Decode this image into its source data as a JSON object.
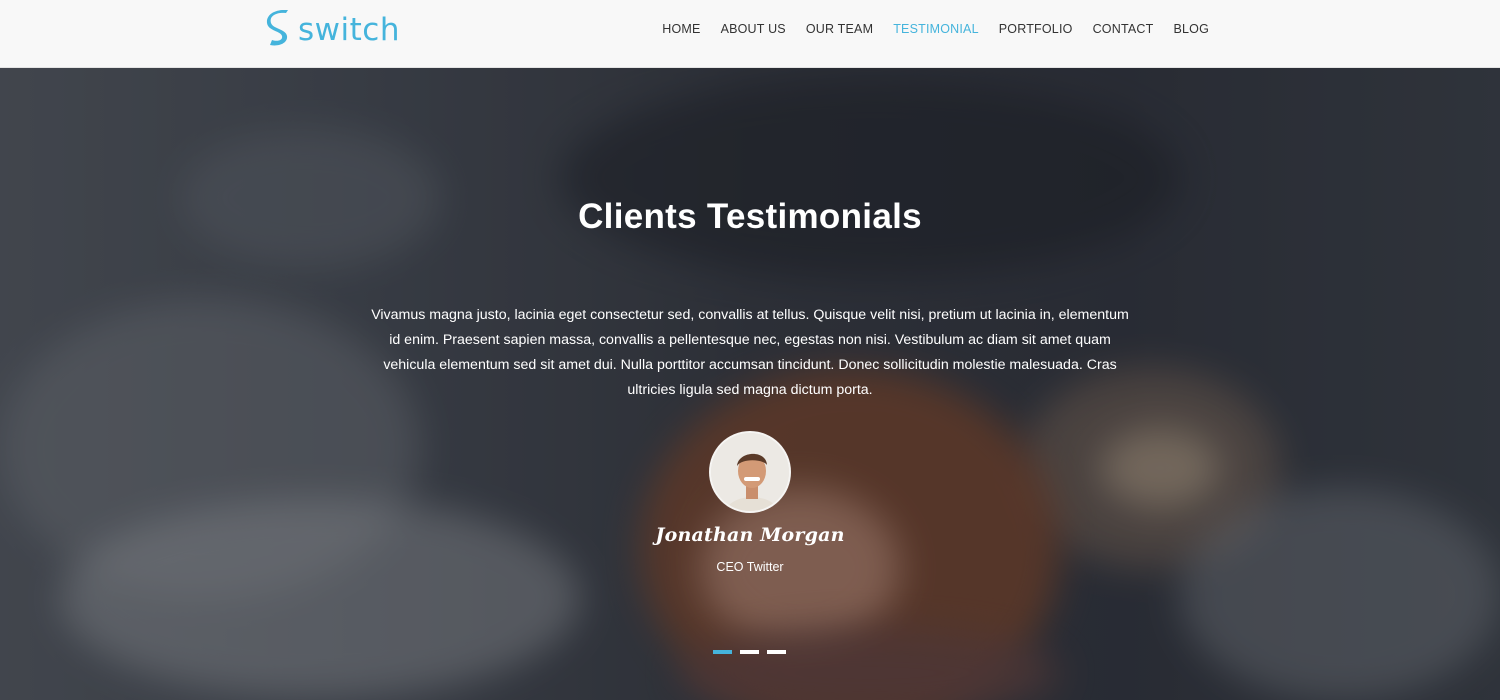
{
  "brand": {
    "name": "switch",
    "accent": "#45b4dc"
  },
  "nav": {
    "items": [
      {
        "label": "HOME",
        "active": false
      },
      {
        "label": "ABOUT US",
        "active": false
      },
      {
        "label": "OUR TEAM",
        "active": false
      },
      {
        "label": "TESTIMONIAL",
        "active": true
      },
      {
        "label": "PORTFOLIO",
        "active": false
      },
      {
        "label": "CONTACT",
        "active": false
      },
      {
        "label": "BLOG",
        "active": false
      }
    ]
  },
  "testimonials": {
    "title": "Clients Testimonials",
    "quote": "Vivamus magna justo, lacinia eget consectetur sed, convallis at tellus. Quisque velit nisi, pretium ut lacinia in, elementum id enim. Praesent sapien massa, convallis a pellentesque nec, egestas non nisi. Vestibulum ac diam sit amet quam vehicula elementum sed sit amet dui. Nulla porttitor accumsan tincidunt. Donec sollicitudin molestie malesuada. Cras ultricies ligula sed magna dictum porta.",
    "client_name": "Jonathan Morgan",
    "client_role": "CEO Twitter",
    "slides": [
      {
        "active": true
      },
      {
        "active": false
      },
      {
        "active": false
      }
    ]
  }
}
